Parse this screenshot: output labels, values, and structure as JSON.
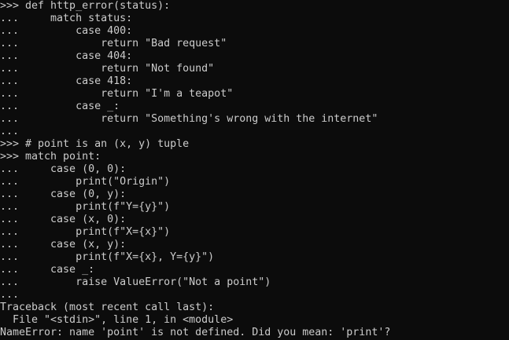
{
  "terminal": {
    "lines": [
      ">>> def http_error(status):",
      "...     match status:",
      "...         case 400:",
      "...             return \"Bad request\"",
      "...         case 404:",
      "...             return \"Not found\"",
      "...         case 418:",
      "...             return \"I'm a teapot\"",
      "...         case _:",
      "...             return \"Something's wrong with the internet\"",
      "...",
      ">>> # point is an (x, y) tuple",
      ">>> match point:",
      "...     case (0, 0):",
      "...         print(\"Origin\")",
      "...     case (0, y):",
      "...         print(f\"Y={y}\")",
      "...     case (x, 0):",
      "...         print(f\"X={x}\")",
      "...     case (x, y):",
      "...         print(f\"X={x}, Y={y}\")",
      "...     case _:",
      "...         raise ValueError(\"Not a point\")",
      "...",
      "Traceback (most recent call last):",
      "  File \"<stdin>\", line 1, in <module>",
      "NameError: name 'point' is not defined. Did you mean: 'print'?"
    ]
  }
}
